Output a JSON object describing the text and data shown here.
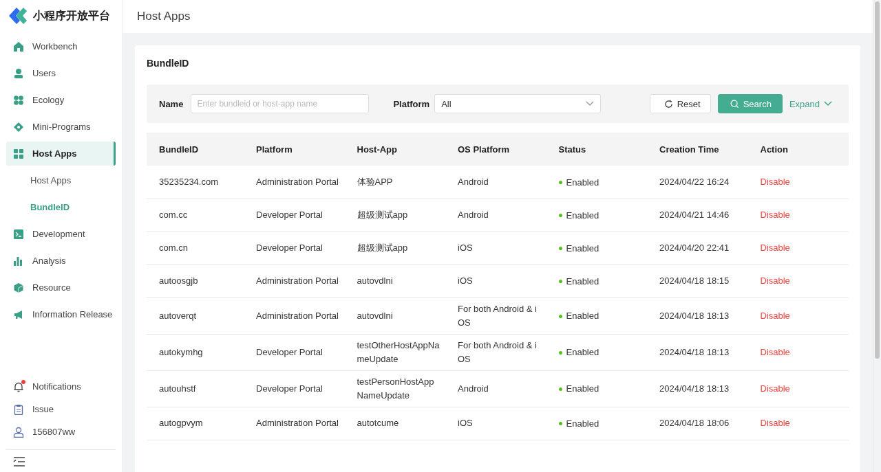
{
  "logo": {
    "title": "小程序开放平台"
  },
  "sidebar": {
    "items": [
      {
        "label": "Workbench",
        "selected": false
      },
      {
        "label": "Users",
        "selected": false
      },
      {
        "label": "Ecology",
        "selected": false
      },
      {
        "label": "Mini-Programs",
        "selected": false
      },
      {
        "label": "Host Apps",
        "selected": true,
        "children": [
          {
            "label": "Host Apps",
            "selected": false
          },
          {
            "label": "BundleID",
            "selected": true
          }
        ]
      },
      {
        "label": "Development",
        "selected": false
      },
      {
        "label": "Analysis",
        "selected": false
      },
      {
        "label": "Resource",
        "selected": false
      },
      {
        "label": "Information Release",
        "selected": false
      }
    ],
    "footer": [
      {
        "label": "Notifications",
        "unread": true
      },
      {
        "label": "Issue",
        "unread": false
      },
      {
        "label": "156807ww",
        "unread": false
      }
    ]
  },
  "header": {
    "title": "Host Apps"
  },
  "card": {
    "title": "BundleID"
  },
  "filters": {
    "name_label": "Name",
    "name_placeholder": "Enter bundleid or host-app name",
    "platform_label": "Platform",
    "platform_value": "All",
    "reset": "Reset",
    "search": "Search",
    "expand": "Expand"
  },
  "table": {
    "columns": [
      "BundleID",
      "Platform",
      "Host-App",
      "OS Platform",
      "Status",
      "Creation Time",
      "Action"
    ],
    "rows": [
      {
        "cells": [
          "35235234.com",
          "Administration Portal",
          "体验APP",
          "Android",
          "Enabled",
          "2024/04/22 16:24",
          "Disable"
        ]
      },
      {
        "cells": [
          "com.cc",
          "Developer Portal",
          "超级测试app",
          "Android",
          "Enabled",
          "2024/04/21 14:46",
          "Disable"
        ]
      },
      {
        "cells": [
          "com.cn",
          "Developer Portal",
          "超级测试app",
          "iOS",
          "Enabled",
          "2024/04/20 22:41",
          "Disable"
        ]
      },
      {
        "cells": [
          "autoosgjb",
          "Administration Portal",
          "autovdlni",
          "iOS",
          "Enabled",
          "2024/04/18 18:15",
          "Disable"
        ]
      },
      {
        "cells": [
          "autoverqt",
          "Administration Portal",
          "autovdlni",
          "For both Android & iOS",
          "Enabled",
          "2024/04/18 18:13",
          "Disable"
        ]
      },
      {
        "cells": [
          "autokymhg",
          "Developer Portal",
          "testOtherHostAppNameUpdate",
          "For both Android & iOS",
          "Enabled",
          "2024/04/18 18:13",
          "Disable"
        ]
      },
      {
        "cells": [
          "autouhstf",
          "Developer Portal",
          "testPersonHostAppNameUpdate",
          "Android",
          "Enabled",
          "2024/04/18 18:13",
          "Disable"
        ]
      },
      {
        "cells": [
          "autogpvym",
          "Administration Portal",
          "autotcume",
          "iOS",
          "Enabled",
          "2024/04/18 18:06",
          "Disable"
        ]
      }
    ]
  }
}
